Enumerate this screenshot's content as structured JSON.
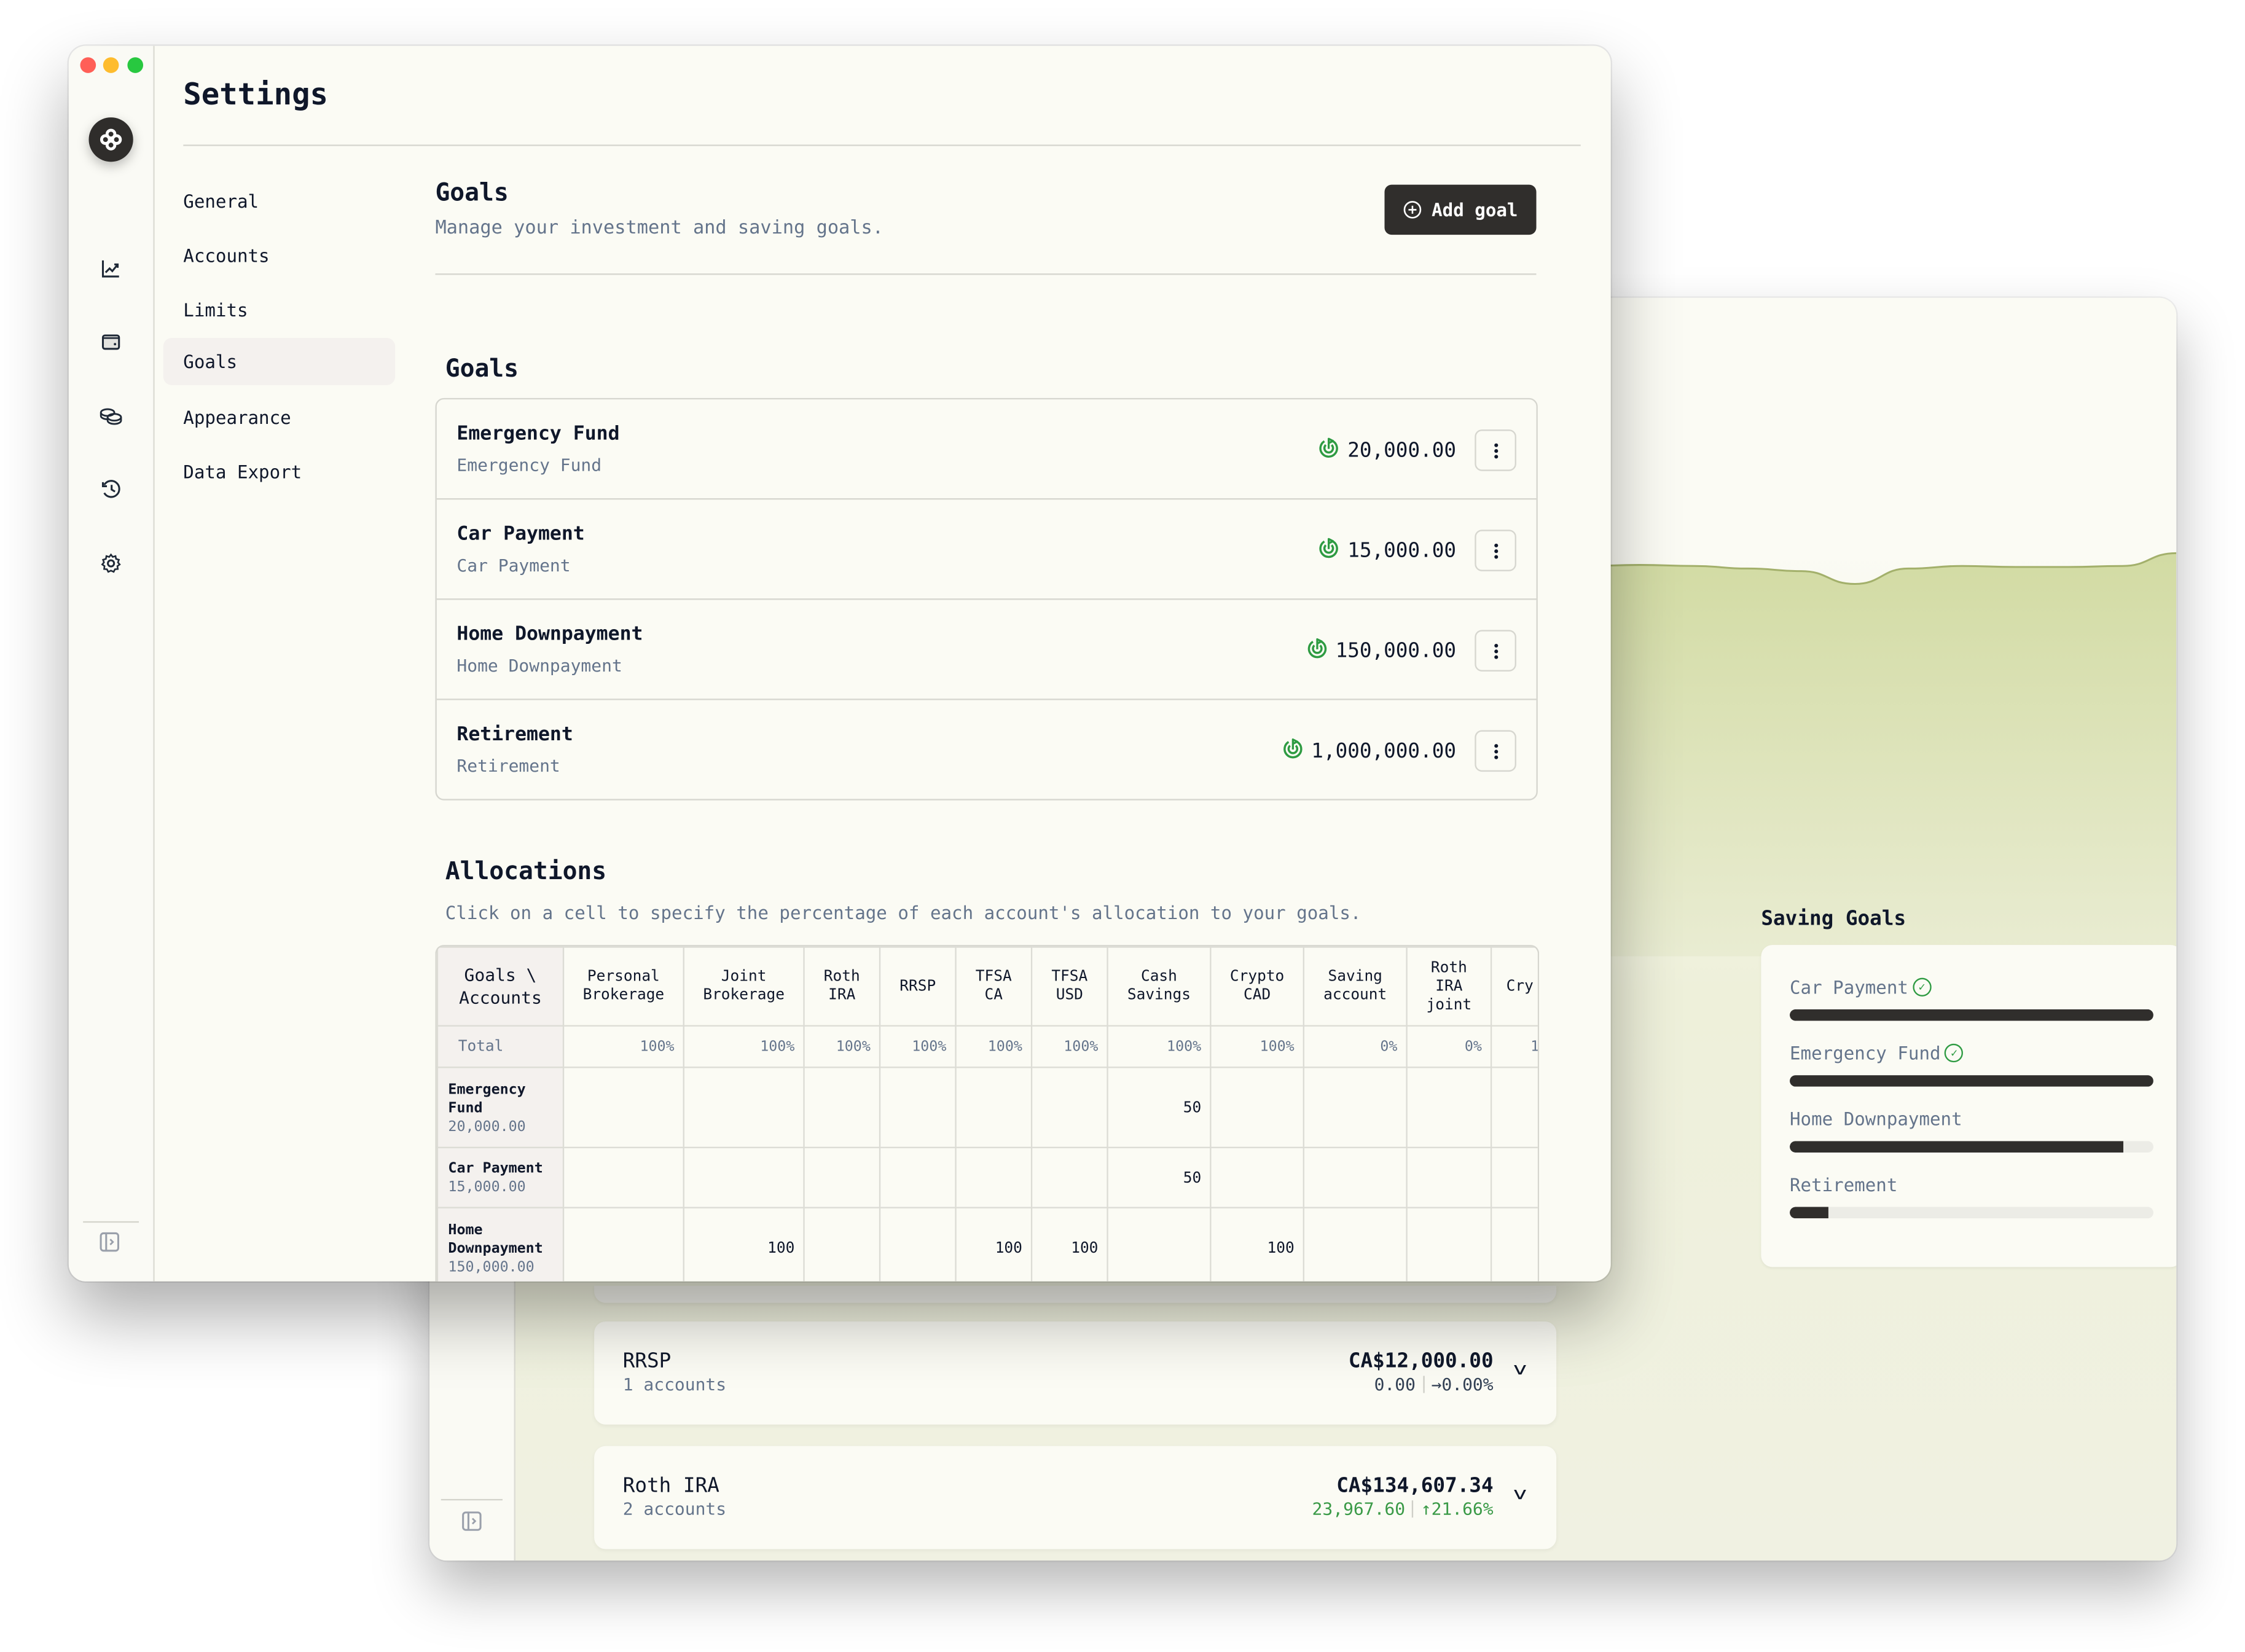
{
  "front_window": {
    "title": "Settings",
    "nav": [
      {
        "label": "General",
        "active": false
      },
      {
        "label": "Accounts",
        "active": false
      },
      {
        "label": "Limits",
        "active": false
      },
      {
        "label": "Goals",
        "active": true
      },
      {
        "label": "Appearance",
        "active": false
      },
      {
        "label": "Data Export",
        "active": false
      }
    ],
    "sidebar_icons": [
      "chart-line-icon",
      "wallet-icon",
      "coins-icon",
      "history-icon",
      "settings-icon"
    ],
    "section": {
      "title": "Goals",
      "description": "Manage your investment and saving goals.",
      "add_button": "Add goal"
    },
    "goals_heading": "Goals",
    "goals": [
      {
        "name": "Emergency Fund",
        "description": "Emergency Fund",
        "amount": "20,000.00"
      },
      {
        "name": "Car Payment",
        "description": "Car Payment",
        "amount": "15,000.00"
      },
      {
        "name": "Home Downpayment",
        "description": "Home Downpayment",
        "amount": "150,000.00"
      },
      {
        "name": "Retirement",
        "description": "Retirement",
        "amount": "1,000,000.00"
      }
    ],
    "allocations": {
      "title": "Allocations",
      "description": "Click on a cell to specify the percentage of each account's allocation to your goals.",
      "corner_label": "Goals \\ Accounts",
      "total_label": "Total",
      "accounts": [
        {
          "name": "Personal Brokerage",
          "total": "100%"
        },
        {
          "name": "Joint Brokerage",
          "total": "100%"
        },
        {
          "name": "Roth IRA",
          "total": "100%"
        },
        {
          "name": "RRSP",
          "total": "100%"
        },
        {
          "name": "TFSA CA",
          "total": "100%"
        },
        {
          "name": "TFSA USD",
          "total": "100%"
        },
        {
          "name": "Cash Savings",
          "total": "100%"
        },
        {
          "name": "Crypto CAD",
          "total": "100%"
        },
        {
          "name": "Saving account",
          "total": "0%"
        },
        {
          "name": "Roth IRA joint",
          "total": "0%"
        },
        {
          "name": "Cry",
          "total": "1"
        }
      ],
      "rows": [
        {
          "goal": "Emergency Fund",
          "amount": "20,000.00",
          "cells": [
            "",
            "",
            "",
            "",
            "",
            "",
            "50",
            "",
            "",
            "",
            ""
          ]
        },
        {
          "goal": "Car Payment",
          "amount": "15,000.00",
          "cells": [
            "",
            "",
            "",
            "",
            "",
            "",
            "50",
            "",
            "",
            "",
            ""
          ]
        },
        {
          "goal": "Home Downpayment",
          "amount": "150,000.00",
          "cells": [
            "",
            "100",
            "",
            "",
            "100",
            "100",
            "",
            "100",
            "",
            "",
            ""
          ]
        }
      ]
    }
  },
  "back_window": {
    "saving_goals": {
      "title": "Saving Goals",
      "items": [
        {
          "name": "Car Payment",
          "progress": 1.0,
          "achieved": true
        },
        {
          "name": "Emergency Fund",
          "progress": 1.0,
          "achieved": true
        },
        {
          "name": "Home Downpayment",
          "progress": 0.916,
          "achieved": false
        },
        {
          "name": "Retirement",
          "progress": 0.105,
          "achieved": false
        }
      ]
    },
    "accounts": [
      {
        "name": "RRSP",
        "sub": "1 accounts",
        "value": "CA$12,000.00",
        "change": "0.00",
        "change_pct": "→0.00%",
        "positive": false
      },
      {
        "name": "Roth IRA",
        "sub": "2 accounts",
        "value": "CA$134,607.34",
        "change": "23,967.60",
        "change_pct": "↑21.66%",
        "positive": true
      }
    ],
    "chart_data": {
      "type": "area",
      "series": [
        {
          "name": "portfolio",
          "values": [
            52,
            52,
            53,
            50,
            49.5,
            49,
            52,
            52,
            52,
            49.5,
            51,
            52.5,
            58,
            58.5,
            58.6,
            75,
            76,
            73.5,
            74.8,
            74.5,
            76,
            76.2,
            76,
            75.5,
            75,
            72.5,
            75.5,
            76,
            75.8,
            75.8,
            76,
            78.5
          ]
        }
      ]
    }
  }
}
